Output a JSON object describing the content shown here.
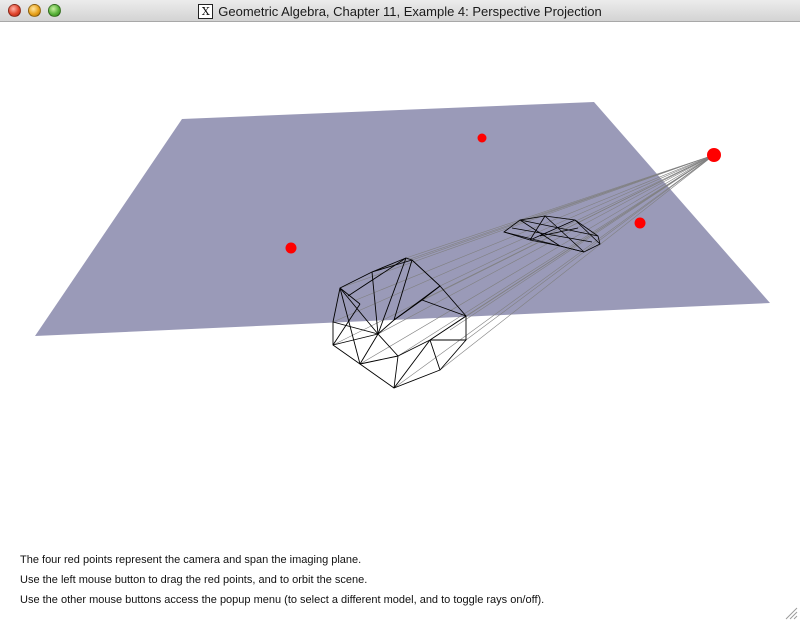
{
  "window": {
    "title": "Geometric Algebra, Chapter 11, Example 4: Perspective Projection",
    "app_icon_glyph": "X",
    "buttons": {
      "close": "close-icon",
      "minimize": "minimize-icon",
      "zoom": "zoom-icon"
    }
  },
  "scene": {
    "plane_color": "#9a9ab8",
    "point_color": "#ff0000",
    "wireframe_color": "#000000",
    "ray_color": "#808080"
  },
  "instructions": [
    "The four red points represent the camera and span the imaging plane.",
    "Use the left mouse button to drag the red points, and to orbit the scene.",
    "Use the other mouse buttons access the popup menu (to select a different model, and to toggle rays on/off)."
  ]
}
